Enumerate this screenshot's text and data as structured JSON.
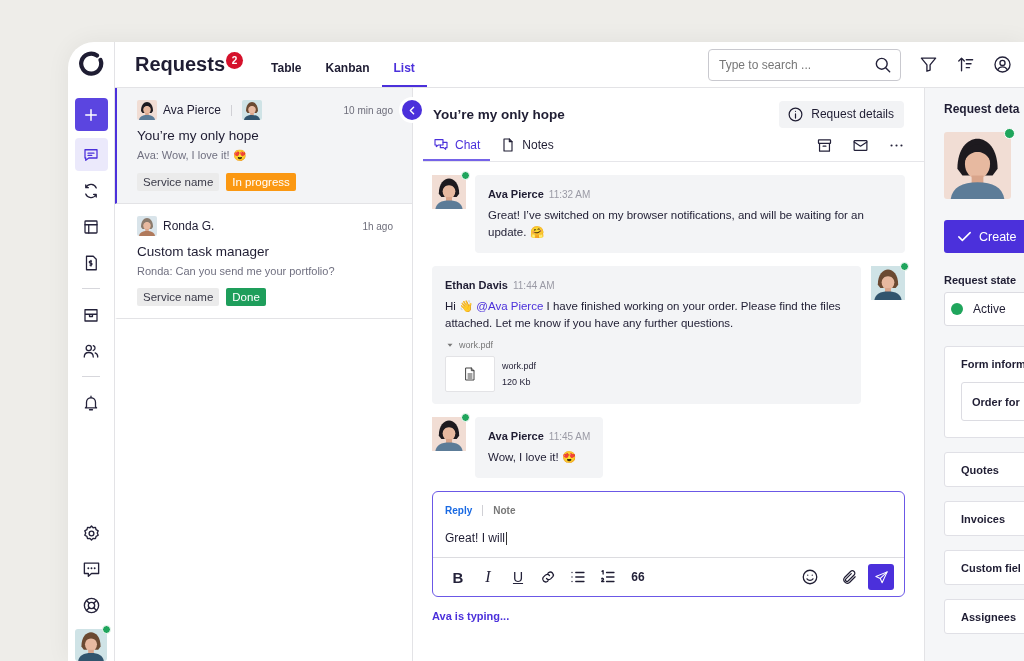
{
  "app": {
    "title": "Requests",
    "badge": "2"
  },
  "view_tabs": [
    {
      "label": "Table",
      "selected": false
    },
    {
      "label": "Kanban",
      "selected": false
    },
    {
      "label": "List",
      "selected": true
    }
  ],
  "search": {
    "placeholder": "Type to search ..."
  },
  "nav": {
    "groups": [
      [
        {
          "selected": true
        },
        {
          "selected": false
        },
        {
          "selected": false
        },
        {
          "selected": false
        }
      ],
      [
        {
          "selected": false
        },
        {
          "selected": false
        }
      ],
      [
        {
          "selected": false
        }
      ]
    ],
    "bottom": [
      {
        "selected": false
      },
      {
        "selected": false
      },
      {
        "selected": false
      }
    ],
    "user": {
      "online": true
    }
  },
  "requests": [
    {
      "selected": true,
      "author": "Ava Pierce",
      "avatars": [
        {
          "kind": "picture"
        },
        {
          "kind": "picture"
        }
      ],
      "time": "10 min ago",
      "title": "You’re my only hope",
      "preview": "Ava: Wow, I love it! 😍",
      "tags": [
        {
          "label": "Service name",
          "color": "#ebebeb"
        },
        {
          "label": "In progress",
          "color": "#fb9812"
        }
      ]
    },
    {
      "selected": false,
      "author": "Ronda G.",
      "avatars": [
        {
          "kind": "picture"
        }
      ],
      "time": "1h ago",
      "title": "Custom task manager",
      "preview": "Ronda: Can you send me your portfolio?",
      "tags": [
        {
          "label": "Service name",
          "color": "#ebebeb"
        },
        {
          "label": "Done",
          "color": "#1e9e5b"
        }
      ]
    }
  ],
  "chat": {
    "title": "You’re my only hope",
    "details_button": "Request details",
    "tabs": [
      {
        "label": "Chat",
        "selected": true
      },
      {
        "label": "Notes",
        "selected": false
      }
    ],
    "messages": [
      {
        "kind": "incoming",
        "online": true,
        "author": "Ava Pierce",
        "time": "11:32 AM",
        "text": "Great! I’ve switched on my browser notifications, and will be waiting for an update. 🤗"
      },
      {
        "kind": "outgoing",
        "online": true,
        "author": "Ethan Davis",
        "time": "11:44 AM",
        "text": "Hi 👋",
        "mention": "@Ava Pierce",
        "text_after": "I have finished working on your order. Please find the files attached. Let me know if you have any further questions.",
        "attachment": {
          "toggle": "work.pdf",
          "name": "work.pdf",
          "size": "120 Kb"
        }
      },
      {
        "kind": "incoming",
        "online": true,
        "author": "Ava Pierce",
        "time": "11:45 AM",
        "text": "Wow, I love it! 😍"
      }
    ],
    "composer": {
      "modes": [
        {
          "label": "Reply",
          "selected": true
        },
        {
          "label": "Note",
          "selected": false
        }
      ],
      "value": "Great! I will",
      "format": [
        {
          "kind": "text",
          "label": "B"
        },
        {
          "kind": "text",
          "label": "I"
        },
        {
          "kind": "text",
          "label": "U"
        },
        {
          "kind": "icon"
        },
        {
          "kind": "icon"
        },
        {
          "kind": "icon"
        },
        {
          "kind": "text",
          "label": "66"
        }
      ]
    },
    "typing": "Ava is typing..."
  },
  "details": {
    "title": "Request deta",
    "online": true,
    "create_button": "Create",
    "state_label": "Request state",
    "state": {
      "value": "Active",
      "color": "#1fa55c"
    },
    "form": {
      "title": "Form inform",
      "items": [
        "Order for"
      ]
    },
    "sections": [
      "Quotes",
      "Invoices",
      "Custom fiel",
      "Assignees"
    ]
  }
}
